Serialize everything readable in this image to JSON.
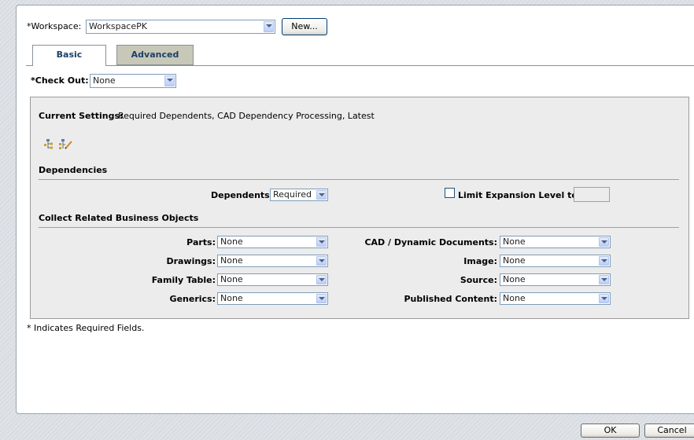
{
  "workspace": {
    "label": "*Workspace:",
    "value": "WorkspacePK",
    "new_button": "New..."
  },
  "tabs": [
    {
      "label": "Basic"
    },
    {
      "label": "Advanced"
    }
  ],
  "checkout": {
    "label": "*Check Out:",
    "value": "None"
  },
  "current_settings": {
    "label": "Current Settings:",
    "value": "Required Dependents, CAD Dependency Processing, Latest"
  },
  "dependencies": {
    "heading": "Dependencies",
    "dependents_label": "Dependents:",
    "dependents_value": "Required",
    "limit_label": "Limit Expansion Level to:",
    "limit_checked": false,
    "limit_value": ""
  },
  "collect": {
    "heading": "Collect Related Business Objects",
    "left": [
      {
        "label": "Parts:",
        "value": "None"
      },
      {
        "label": "Drawings:",
        "value": "None"
      },
      {
        "label": "Family Table:",
        "value": "None"
      },
      {
        "label": "Generics:",
        "value": "None"
      }
    ],
    "right": [
      {
        "label": "CAD / Dynamic Documents:",
        "value": "None"
      },
      {
        "label": "Image:",
        "value": "None"
      },
      {
        "label": "Source:",
        "value": "None"
      },
      {
        "label": "Published Content:",
        "value": "None"
      }
    ]
  },
  "required_note": "* Indicates Required Fields.",
  "footer": {
    "ok": "OK",
    "cancel": "Cancel"
  },
  "icons": [
    "structure-tree-icon",
    "edit-structure-icon"
  ]
}
